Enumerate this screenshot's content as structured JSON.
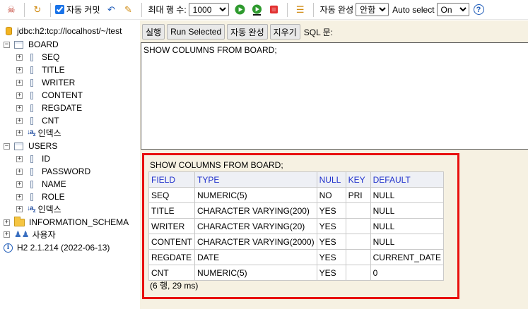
{
  "toolbar": {
    "autocommit_label": "자동 커밋",
    "autocommit_checked": true,
    "max_rows_label": "최대 행 수:",
    "max_rows_value": "1000",
    "autocomplete_label": "자동 완성",
    "autocomplete_value": "안함",
    "autoselect_label": "Auto select",
    "autoselect_value": "On",
    "icons": [
      "disconnect-icon",
      "refresh-icon",
      "rollback-icon",
      "commit-icon",
      "run-icon",
      "run-selected-icon",
      "stop-icon",
      "history-icon",
      "help-icon"
    ]
  },
  "tree": {
    "connection": "jdbc:h2:tcp://localhost/~/test",
    "tables": [
      {
        "name": "BOARD",
        "columns": [
          "SEQ",
          "TITLE",
          "WRITER",
          "CONTENT",
          "REGDATE",
          "CNT"
        ],
        "index_label": "인덱스"
      },
      {
        "name": "USERS",
        "columns": [
          "ID",
          "PASSWORD",
          "NAME",
          "ROLE"
        ],
        "index_label": "인덱스"
      }
    ],
    "schema": "INFORMATION_SCHEMA",
    "users": "사용자",
    "version": "H2 2.1.214 (2022-06-13)"
  },
  "query": {
    "run_label": "실행",
    "run_selected_label": "Run Selected",
    "autocomplete_label": "자동 완성",
    "clear_label": "지우기",
    "sql_label": "SQL 문:",
    "sql_text": "SHOW COLUMNS FROM BOARD;"
  },
  "result": {
    "sql": "SHOW COLUMNS FROM BOARD;",
    "headers": [
      "FIELD",
      "TYPE",
      "NULL",
      "KEY",
      "DEFAULT"
    ],
    "rows": [
      [
        "SEQ",
        "NUMERIC(5)",
        "NO",
        "PRI",
        "NULL"
      ],
      [
        "TITLE",
        "CHARACTER VARYING(200)",
        "YES",
        "",
        "NULL"
      ],
      [
        "WRITER",
        "CHARACTER VARYING(20)",
        "YES",
        "",
        "NULL"
      ],
      [
        "CONTENT",
        "CHARACTER VARYING(2000)",
        "YES",
        "",
        "NULL"
      ],
      [
        "REGDATE",
        "DATE",
        "YES",
        "",
        "CURRENT_DATE"
      ],
      [
        "CNT",
        "NUMERIC(5)",
        "YES",
        "",
        "0"
      ]
    ],
    "footer": "(6 행, 29 ms)"
  },
  "colors": {
    "highlight_border": "#e8100e",
    "panel_background": "#f6f1e2",
    "header_text": "#2233cc"
  }
}
